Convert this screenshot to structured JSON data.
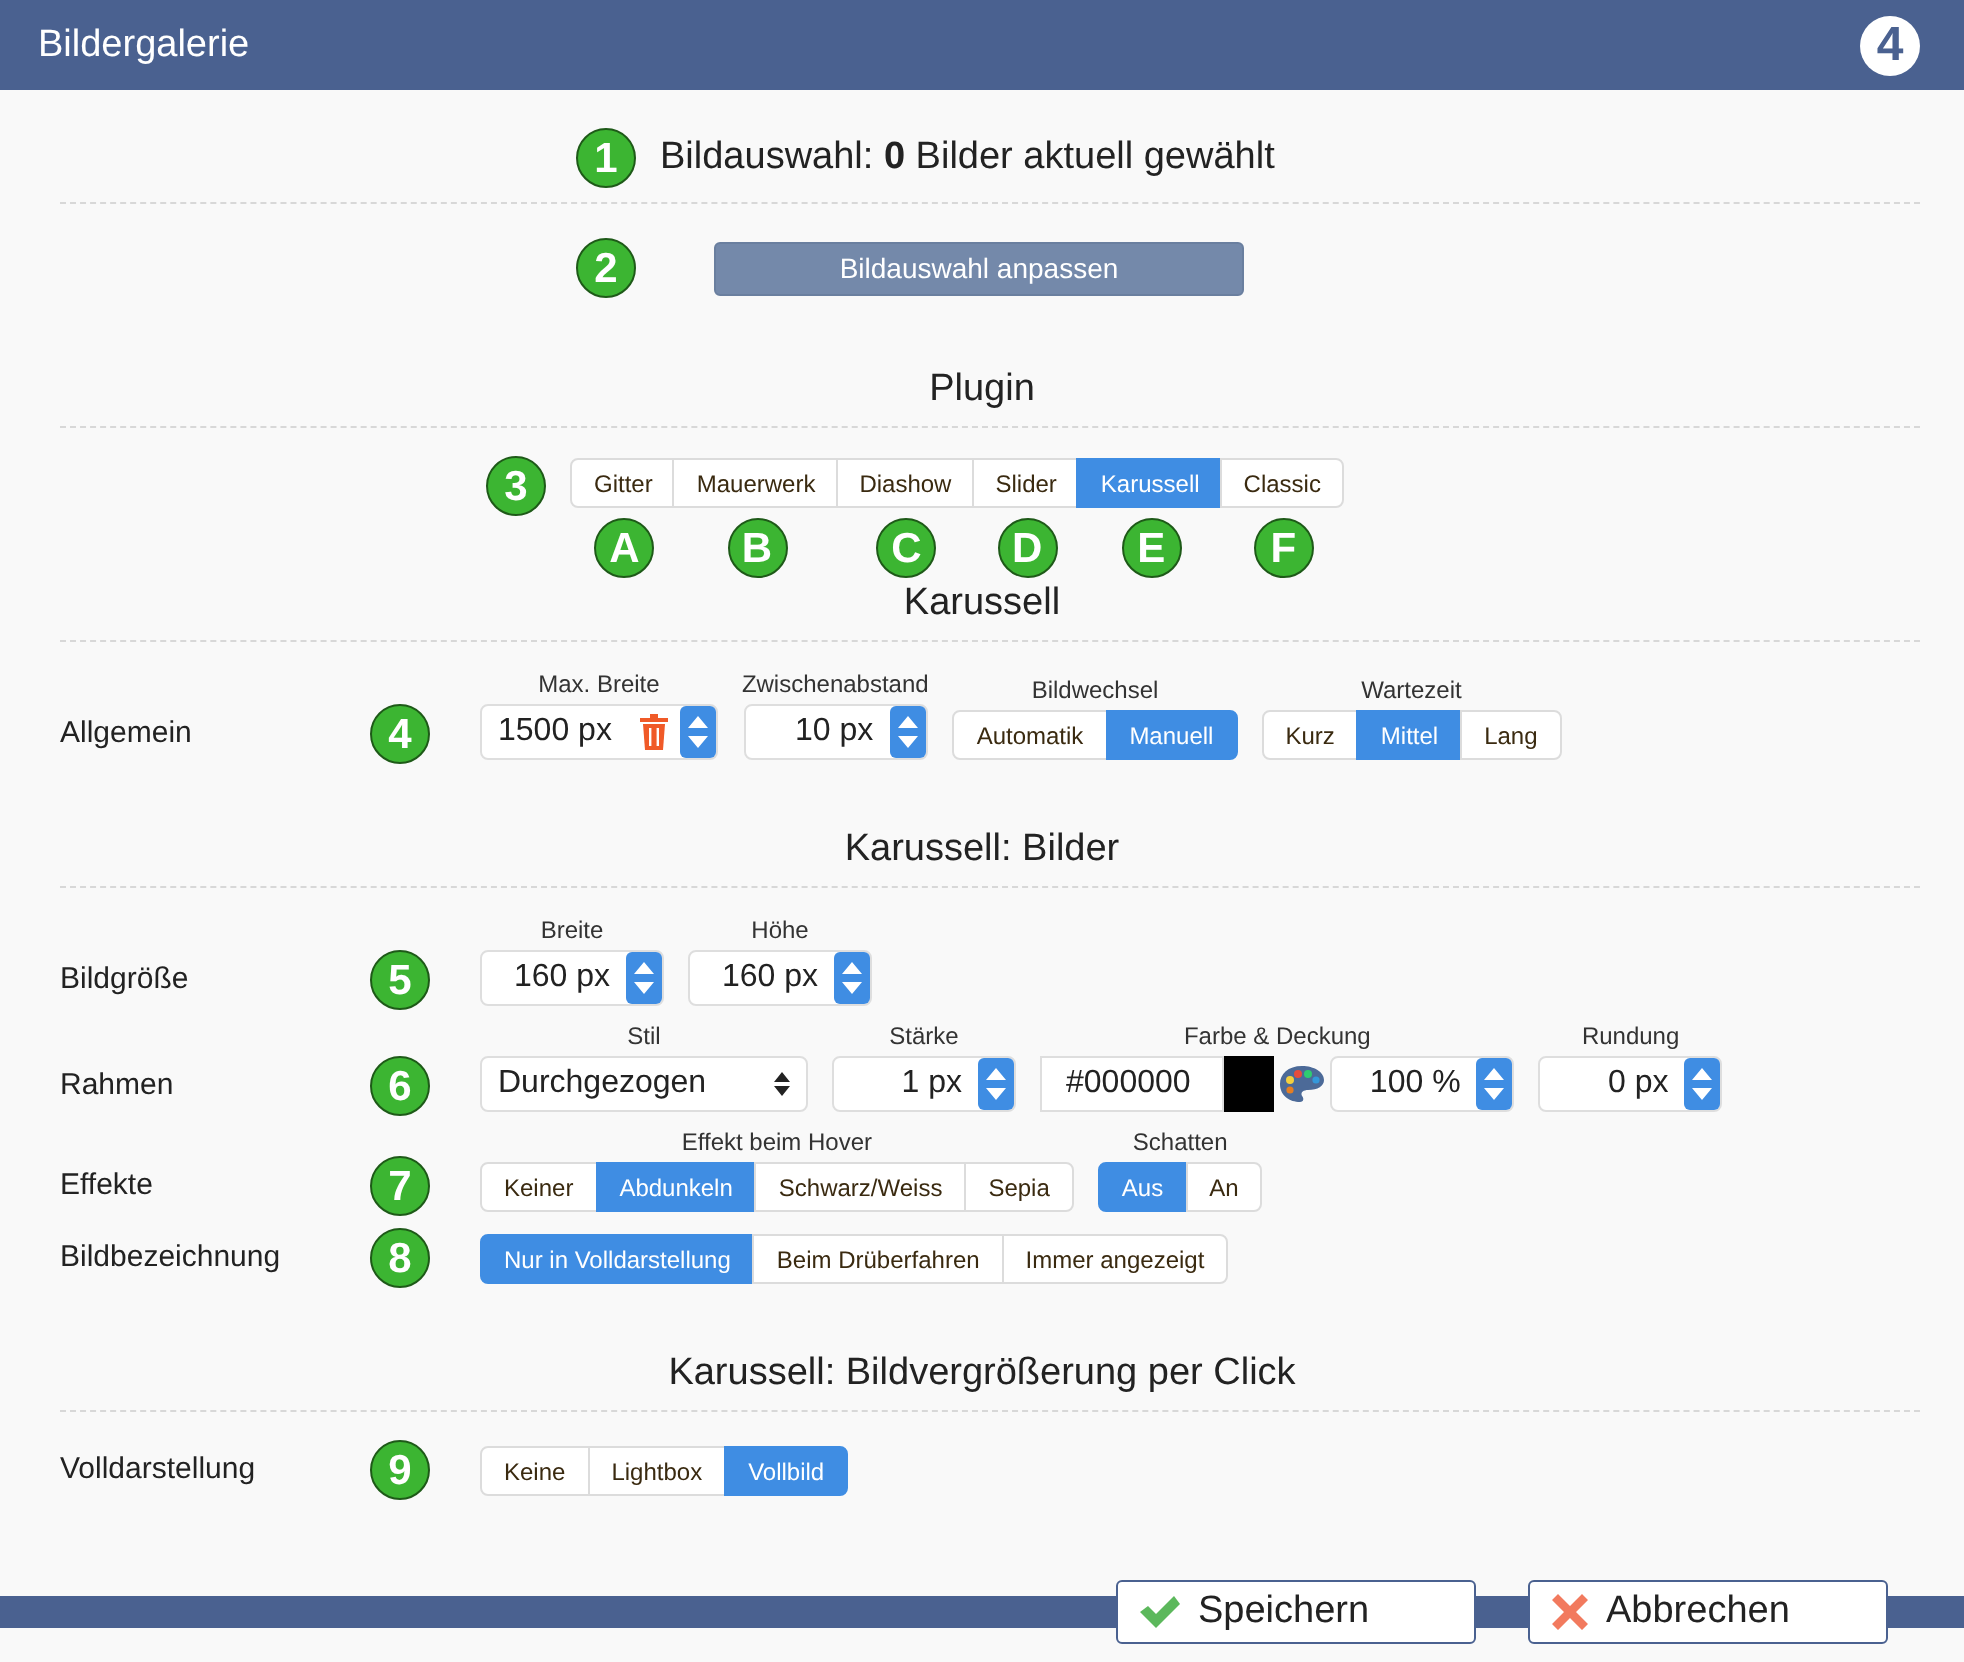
{
  "window": {
    "title": "Bildergalerie",
    "logo": "4"
  },
  "selection": {
    "marker": "1",
    "text": "Bildauswahl: **0** Bilder aktuell gewählt"
  },
  "adjust": {
    "marker": "2",
    "label": "Bildauswahl anpassen"
  },
  "plugin": {
    "title": "Plugin",
    "marker": "3",
    "options": [
      {
        "label": "Gitter",
        "marker": "A",
        "selected": false
      },
      {
        "label": "Mauerwerk",
        "marker": "B",
        "selected": false
      },
      {
        "label": "Diashow",
        "marker": "C",
        "selected": false
      },
      {
        "label": "Slider",
        "marker": "D",
        "selected": false
      },
      {
        "label": "Karussell",
        "marker": "E",
        "selected": true
      },
      {
        "label": "Classic",
        "marker": "F",
        "selected": false
      }
    ]
  },
  "sections": [
    {
      "title": "Karussell",
      "rows": [
        {
          "label": "Allgemein",
          "marker": "4",
          "controls": [
            {
              "kind": "number",
              "caption": "Max. Breite",
              "value": "1500",
              "unit": "px",
              "removable": true
            },
            {
              "kind": "number",
              "caption": "Zwischenabstand",
              "value": "10",
              "unit": "px"
            },
            {
              "kind": "choice",
              "caption": "Bildwechsel",
              "options": [
                {
                  "label": "Automatik",
                  "selected": false
                },
                {
                  "label": "Manuell",
                  "selected": true
                }
              ]
            },
            {
              "kind": "choice",
              "caption": "Wartezeit",
              "options": [
                {
                  "label": "Kurz",
                  "selected": false
                },
                {
                  "label": "Mittel",
                  "selected": true
                },
                {
                  "label": "Lang",
                  "selected": false
                }
              ]
            }
          ]
        }
      ]
    },
    {
      "title": "Karussell: Bilder",
      "rows": [
        {
          "label": "Bildgröße",
          "marker": "5",
          "controls": [
            {
              "kind": "number",
              "caption": "Breite",
              "value": "160",
              "unit": "px"
            },
            {
              "kind": "number",
              "caption": "Höhe",
              "value": "160",
              "unit": "px"
            }
          ]
        },
        {
          "label": "Rahmen",
          "marker": "6",
          "controls": [
            {
              "kind": "select",
              "caption": "Stil",
              "value": "Durchgezogen"
            },
            {
              "kind": "number",
              "caption": "Stärke",
              "value": "1",
              "unit": "px"
            },
            {
              "kind": "color",
              "caption": "Farbe & Deckung",
              "value": "#000000",
              "color": "#000000",
              "opacity": "100",
              "unit": "%"
            },
            {
              "kind": "number",
              "caption": "Rundung",
              "value": "0",
              "unit": "px"
            }
          ]
        },
        {
          "label": "Effekte",
          "marker": "7",
          "controls": [
            {
              "kind": "choice",
              "caption": "Effekt beim Hover",
              "options": [
                {
                  "label": "Keiner",
                  "selected": false
                },
                {
                  "label": "Abdunkeln",
                  "selected": true
                },
                {
                  "label": "Schwarz/Weiss",
                  "selected": false
                },
                {
                  "label": "Sepia",
                  "selected": false
                }
              ]
            },
            {
              "kind": "choice",
              "caption": "Schatten",
              "options": [
                {
                  "label": "Aus",
                  "selected": true
                },
                {
                  "label": "An",
                  "selected": false
                }
              ]
            }
          ]
        },
        {
          "label": "Bildbezeichnung",
          "marker": "8",
          "controls": [
            {
              "kind": "choice",
              "options": [
                {
                  "label": "Nur in Volldarstellung",
                  "selected": true
                },
                {
                  "label": "Beim Drüberfahren",
                  "selected": false
                },
                {
                  "label": "Immer angezeigt",
                  "selected": false
                }
              ]
            }
          ]
        }
      ]
    },
    {
      "title": "Karussell: Bildvergrößerung per Click",
      "rows": [
        {
          "label": "Volldarstellung",
          "marker": "9",
          "controls": [
            {
              "kind": "choice",
              "options": [
                {
                  "label": "Keine",
                  "selected": false
                },
                {
                  "label": "Lightbox",
                  "selected": false
                },
                {
                  "label": "Vollbild",
                  "selected": true
                }
              ]
            }
          ]
        }
      ]
    }
  ],
  "footer": {
    "buttons": [
      {
        "label": "Speichern",
        "kind": "save"
      },
      {
        "label": "Abbrechen",
        "kind": "cancel"
      }
    ]
  }
}
